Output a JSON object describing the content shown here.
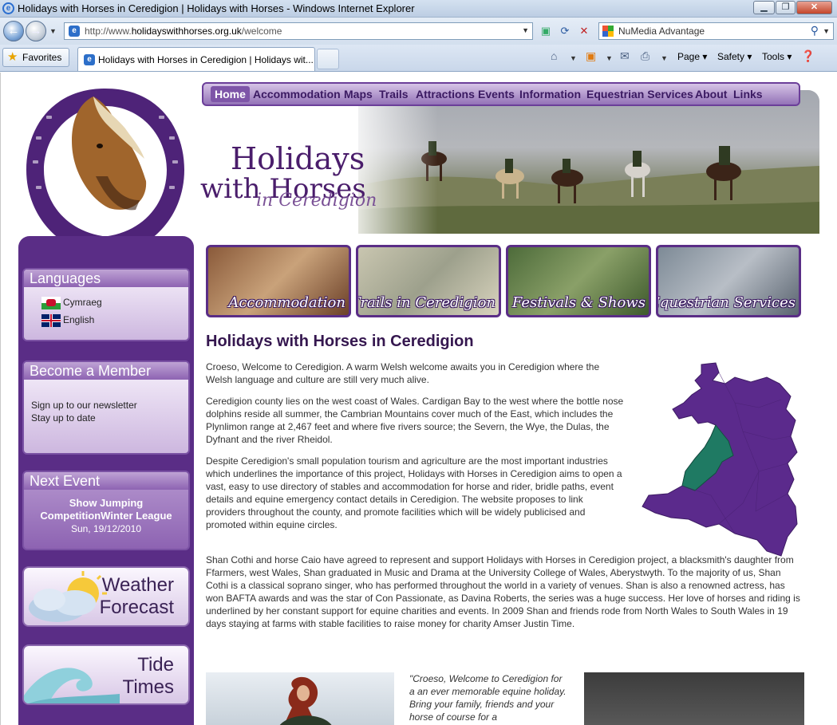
{
  "browser": {
    "window_title": "Holidays with Horses in Ceredigion | Holidays with Horses - Windows Internet Explorer",
    "url_prefix": "http://www.",
    "url_domain": "holidayswithhorses.org.uk",
    "url_path": "/welcome",
    "search_provider": "NuMedia Advantage",
    "favorites_label": "Favorites",
    "tab_title": "Holidays with Horses in Ceredigion | Holidays wit...",
    "commands": [
      "Page",
      "Safety",
      "Tools"
    ]
  },
  "nav": {
    "items": [
      "Home",
      "Accommodation",
      "Maps",
      "Trails",
      "Attractions",
      "Events",
      "Information",
      "Equestrian Services",
      "About",
      "Links"
    ],
    "active": "Home"
  },
  "brand": {
    "line1": "Holidays",
    "line2": "with Horses",
    "line3": "in Ceredigion"
  },
  "tiles": [
    "Accommodation",
    "Trails in Ceredigion",
    "Festivals & Shows",
    "Equestrian Services"
  ],
  "sidebar": {
    "languages": {
      "title": "Languages",
      "items": [
        "Cymraeg",
        "English"
      ]
    },
    "member": {
      "title": "Become a Member",
      "line1": "Sign up to our newsletter",
      "line2": "Stay up to date"
    },
    "event": {
      "title": "Next Event",
      "name_line1": "Show Jumping",
      "name_line2": "CompetitionWinter League",
      "date": "Sun, 19/12/2010"
    },
    "weather": {
      "line1": "Weather",
      "line2": "Forecast"
    },
    "tide": {
      "line1": "Tide",
      "line2": "Times"
    }
  },
  "main": {
    "title": "Holidays with Horses in Ceredigion",
    "paragraphs": [
      "Croeso, Welcome to Ceredigion.  A warm Welsh welcome awaits you in Ceredigion where the Welsh language and culture are still very much alive.",
      "Ceredigion county lies on the west coast of Wales. Cardigan Bay to the west where the bottle nose dolphins reside all summer, the Cambrian Mountains cover much of the East, which includes the Plynlimon range at 2,467 feet and where five rivers source; the Severn, the Wye, the Dulas, the Dyfnant and the river Rheidol.",
      "Despite Ceredigion's small population tourism and agriculture are the most important industries which underlines the importance of this project, Holidays with Horses in Ceredigion aims to open a vast, easy to use directory of stables and accommodation for horse and rider, bridle paths, event details and equine emergency contact details in Ceredigion.  The website proposes to link providers throughout the county, and promote facilities which will be widely publicised and promoted within equine circles.",
      " Shan Cothi and horse Caio have agreed to represent and support Holidays with Horses in Ceredigion project, a blacksmith's daughter from Ffarmers, west Wales, Shan graduated in Music and Drama at the University College of Wales, Aberystwyth.  To the majority of us, Shan Cothi is a classical soprano singer, who has performed throughout the world in a variety of venues.  Shan is also a renowned actress, has won BAFTA awards and was the star of Con Passionate, as Davina Roberts, the series was a huge success.  Her love of horses and riding is underlined by her constant support for equine charities and events.  In 2009 Shan and friends rode from North Wales to South Wales in 19 days staying at farms with stable facilities to raise money for charity Amser Justin Time."
    ],
    "quote": "\"Croeso, Welcome to Ceredigion for a an ever memorable equine holiday. Bring your family, friends and your horse of course for a"
  },
  "colors": {
    "purple": "#5a2d86",
    "ceredigion": "#1f7a63",
    "wales": "#5b2a8c"
  }
}
